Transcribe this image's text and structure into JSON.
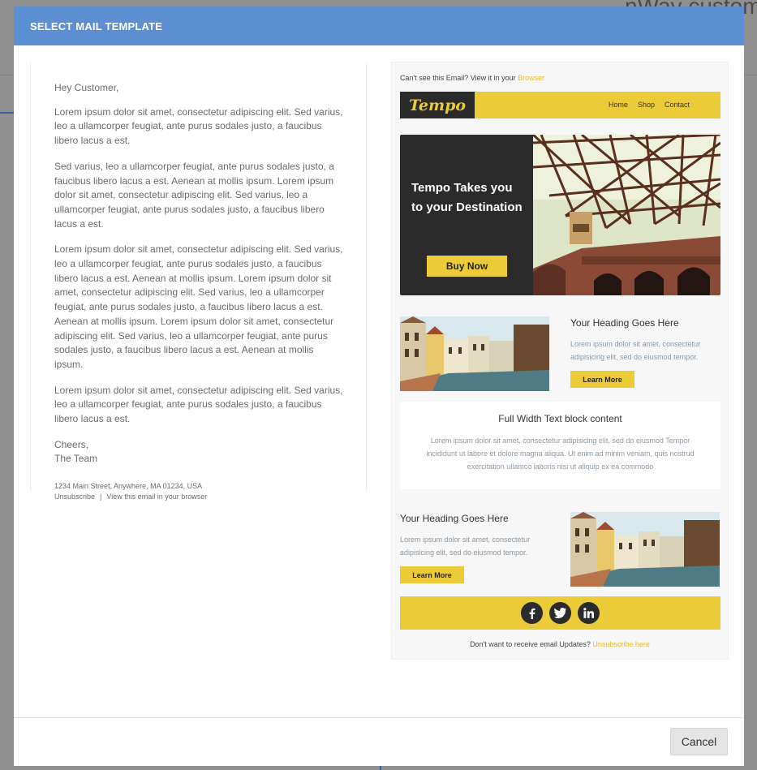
{
  "background": {
    "page_title": "nWay custom"
  },
  "modal": {
    "title": "SELECT MAIL TEMPLATE",
    "cancel_label": "Cancel"
  },
  "plain_template": {
    "greeting": "Hey Customer,",
    "paragraphs": [
      "Lorem ipsum dolor sit amet, consectetur adipiscing elit. Sed varius, leo a ullamcorper feugiat, ante purus sodales justo, a faucibus libero lacus a est.",
      "Sed varius, leo a ullamcorper feugiat, ante purus sodales justo, a faucibus libero lacus a est. Aenean at mollis ipsum. Lorem ipsum dolor sit amet, consectetur adipiscing elit. Sed varius, leo a ullamcorper feugiat, ante purus sodales justo, a faucibus libero lacus a est.",
      "Lorem ipsum dolor sit amet, consectetur adipiscing elit. Sed varius, leo a ullamcorper feugiat, ante purus sodales justo, a faucibus libero lacus a est. Aenean at mollis ipsum. Lorem ipsum dolor sit amet, consectetur adipiscing elit. Sed varius, leo a ullamcorper feugiat, ante purus sodales justo, a faucibus libero lacus a est. Aenean at mollis ipsum. Lorem ipsum dolor sit amet, consectetur adipiscing elit. Sed varius, leo a ullamcorper feugiat, ante purus sodales justo, a faucibus libero lacus a est. Aenean at mollis ipsum.",
      "Lorem ipsum dolor sit amet, consectetur adipiscing elit. Sed varius, leo a ullamcorper feugiat, ante purus sodales justo, a faucibus libero lacus a est."
    ],
    "sign_line1": "Cheers,",
    "sign_line2": "The Team",
    "address": "1234 Main Street, Anywhere, MA 01234, USA",
    "unsubscribe": "Unsubscribe",
    "separator": "|",
    "view_in_browser": "View this email in your browser"
  },
  "rich_template": {
    "top_text": "Can't see this Email? View it in your",
    "top_link": "Browser",
    "logo": "Tempo",
    "nav": [
      "Home",
      "Shop",
      "Contact"
    ],
    "hero_title": "Tempo Takes you to your Destination",
    "hero_button": "Buy Now",
    "block1": {
      "heading": "Your Heading Goes Here",
      "text": "Lorem ipsum dolor sit amet, consectetur adipisicing elit, sed do eiusmod tempor.",
      "button": "Learn More"
    },
    "full_width": {
      "heading": "Full Width Text block content",
      "text": "Lorem ipsum dolor sit amet, consectetur adipisicing elit, sed do eiusmod Tempor incididunt ut labore et dolore magna aliqua. Ut enim ad minim veniam, quis nostrud exercitation ullamco laboris nisi ut aliquip ex ea commodo"
    },
    "block2": {
      "heading": "Your Heading Goes Here",
      "text": "Lorem ipsum dolor sit amet, consectetur adipisicing elit, sed do eiusmod tempor.",
      "button": "Learn More"
    },
    "social_icons": [
      "facebook-icon",
      "twitter-icon",
      "linkedin-icon"
    ],
    "bottom_text": "Don't want to receive email Updates?",
    "bottom_link": "Unsubscribe here"
  },
  "colors": {
    "header_blue": "#5b8fd2",
    "accent_yellow": "#eccb38",
    "dark": "#2b2b2b"
  }
}
